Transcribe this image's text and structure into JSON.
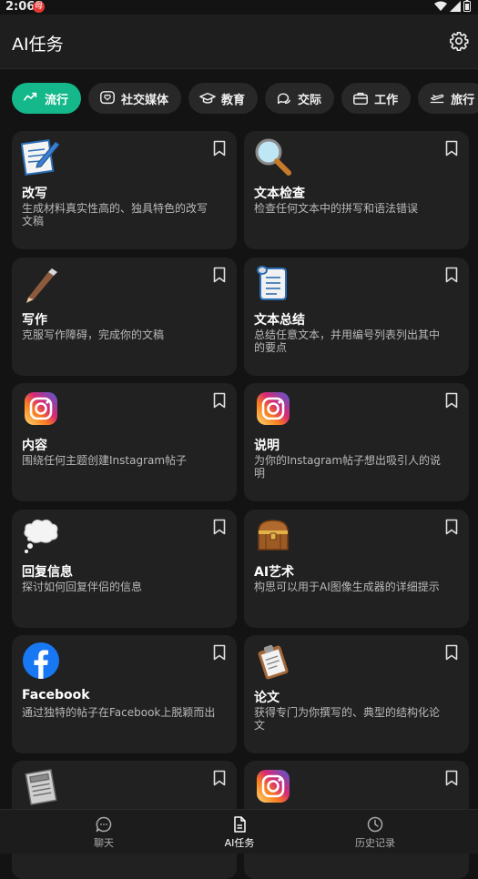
{
  "status": {
    "time": "2:06",
    "notif_badge": "母"
  },
  "appbar": {
    "title": "AI任务",
    "settings_icon": "gear-icon"
  },
  "categories": [
    {
      "label": "流行",
      "icon": "trending-icon",
      "active": true
    },
    {
      "label": "社交媒体",
      "icon": "heart-chat-icon",
      "active": false
    },
    {
      "label": "教育",
      "icon": "graduation-cap-icon",
      "active": false
    },
    {
      "label": "交际",
      "icon": "chat-bubbles-icon",
      "active": false
    },
    {
      "label": "工作",
      "icon": "briefcase-icon",
      "active": false
    },
    {
      "label": "旅行",
      "icon": "plane-icon",
      "active": false
    }
  ],
  "cards": [
    {
      "title": "改写",
      "desc": "生成材料真实性高的、独具特色的改写文稿",
      "icon": "notepad-pen-icon"
    },
    {
      "title": "文本检查",
      "desc": "检查任何文本中的拼写和语法错误",
      "icon": "magnifier-icon"
    },
    {
      "title": "写作",
      "desc": "克服写作障碍，完成你的文稿",
      "icon": "pen-icon"
    },
    {
      "title": "文本总结",
      "desc": "总结任意文本，并用编号列表列出其中的要点",
      "icon": "scroll-icon"
    },
    {
      "title": "内容",
      "desc": "围绕任何主题创建Instagram帖子",
      "icon": "instagram-icon"
    },
    {
      "title": "说明",
      "desc": "为你的Instagram帖子想出吸引人的说明",
      "icon": "instagram-icon"
    },
    {
      "title": "回复信息",
      "desc": "探讨如何回复伴侣的信息",
      "icon": "thought-bubble-icon"
    },
    {
      "title": "AI艺术",
      "desc": "构思可以用于AI图像生成器的详细提示",
      "icon": "treasure-chest-icon"
    },
    {
      "title": "Facebook",
      "desc": "通过独特的帖子在Facebook上脱颖而出",
      "icon": "facebook-icon"
    },
    {
      "title": "论文",
      "desc": "获得专门为你撰写的、典型的结构化论文",
      "icon": "clipboard-icon"
    },
    {
      "title": "",
      "desc": "",
      "icon": "newspaper-icon"
    },
    {
      "title": "",
      "desc": "",
      "icon": "instagram-icon"
    }
  ],
  "bottom_nav": [
    {
      "label": "聊天",
      "icon": "chat-icon",
      "active": false
    },
    {
      "label": "AI任务",
      "icon": "document-icon",
      "active": true
    },
    {
      "label": "历史记录",
      "icon": "clock-icon",
      "active": false
    }
  ],
  "colors": {
    "accent": "#14b88a",
    "background": "#131313",
    "card": "#212121",
    "chip": "#282828"
  }
}
